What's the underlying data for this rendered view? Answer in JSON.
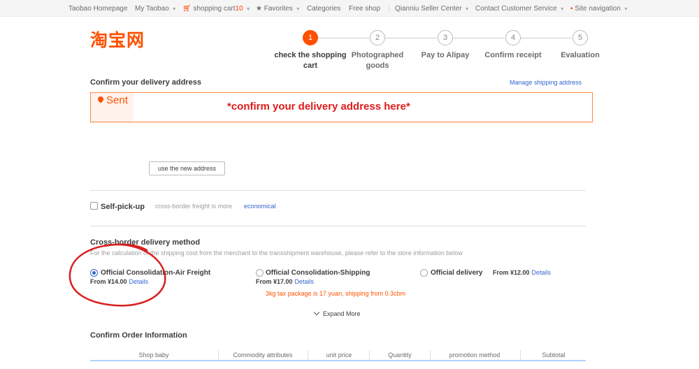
{
  "topbar": {
    "homepage": "Taobao Homepage",
    "my_taobao": "My Taobao",
    "cart_label": "shopping cart",
    "cart_count": "10",
    "favorites": "Favorites",
    "categories": "Categories",
    "free_shop": "Free shop",
    "seller_center": "Qianniu Seller Center",
    "customer_service": "Contact Customer Service",
    "site_nav": "Site navigation"
  },
  "logo": "淘宝网",
  "steps": [
    {
      "num": "1",
      "label": "check the shopping cart"
    },
    {
      "num": "2",
      "label": "Photographed goods"
    },
    {
      "num": "3",
      "label": "Pay to Alipay"
    },
    {
      "num": "4",
      "label": "Confirm receipt"
    },
    {
      "num": "5",
      "label": "Evaluation"
    }
  ],
  "address": {
    "title": "Confirm your delivery address",
    "manage_link": "Manage shipping address",
    "sent_label": "Sent",
    "annotation": "*confirm your delivery address here*",
    "new_address_button": "use the new address"
  },
  "pickup": {
    "label": "Self-pick-up",
    "note": "cross-border freight is more",
    "note_link": "economical"
  },
  "delivery": {
    "title": "Cross-border delivery method",
    "subtitle": "For the calculation of the shipping cost from the merchant to the transshipment warehouse, please refer to the store information below",
    "options": [
      {
        "label": "Official Consolidation-Air Freight",
        "price": "From ¥14.00",
        "details": "Details",
        "selected": true
      },
      {
        "label": "Official Consolidation-Shipping",
        "price": "From ¥17.00",
        "details": "Details",
        "selected": false
      },
      {
        "label": "Official delivery",
        "price": "From ¥12.00",
        "details": "Details",
        "selected": false
      }
    ],
    "promo": "3kg tax package is 17 yuan, shipping from 0.3cbm",
    "expand": "Expand More"
  },
  "order": {
    "title": "Confirm Order Information",
    "columns": [
      "Shop baby",
      "Commodity attributes",
      "unit price",
      "Quantity",
      "promotion method",
      "Subtotal"
    ]
  },
  "colors": {
    "brand": "#ff5000",
    "link": "#3366cc",
    "annotation": "#e01b1b"
  }
}
